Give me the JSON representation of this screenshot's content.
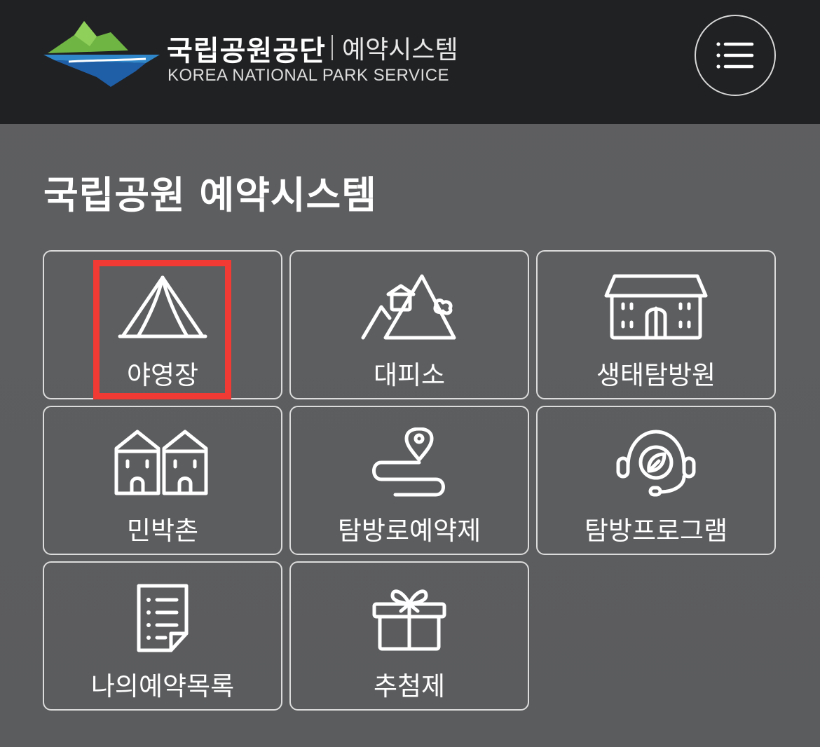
{
  "header": {
    "org_name": "국립공원공단",
    "system_name": "예약시스템",
    "org_name_en": "KOREA NATIONAL PARK SERVICE",
    "menu_icon": "hamburger-menu-icon"
  },
  "page": {
    "title": "국립공원 예약시스템"
  },
  "menu": {
    "items": [
      {
        "label": "야영장",
        "icon": "tent-icon"
      },
      {
        "label": "대피소",
        "icon": "mountain-shelter-icon"
      },
      {
        "label": "생태탐방원",
        "icon": "building-icon"
      },
      {
        "label": "민박촌",
        "icon": "houses-icon"
      },
      {
        "label": "탐방로예약제",
        "icon": "trail-pin-icon"
      },
      {
        "label": "탐방프로그램",
        "icon": "headset-leaf-icon"
      },
      {
        "label": "나의예약목록",
        "icon": "document-list-icon"
      },
      {
        "label": "추첨제",
        "icon": "gift-icon"
      }
    ]
  },
  "colors": {
    "header_bg": "#202123",
    "page_bg": "#5e5f61",
    "highlight": "#f03a33",
    "logo_green": "#7cc14a",
    "logo_blue": "#1f5fa8"
  }
}
